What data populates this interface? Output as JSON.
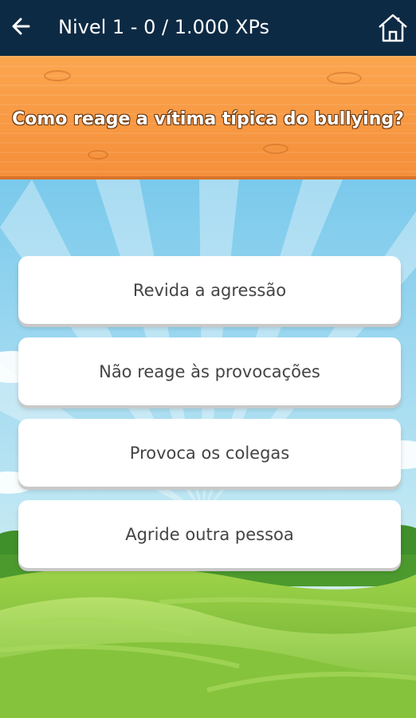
{
  "appbar": {
    "title": "Nivel 1 - 0 / 1.000 XPs",
    "back_icon": "arrow-left-icon",
    "home_icon": "home-icon",
    "background": "#0d2a44"
  },
  "question": {
    "text": "Como reage a vítima típica do bullying?"
  },
  "answers": [
    {
      "label": "Revida a agressão"
    },
    {
      "label": "Não reage às provocações"
    },
    {
      "label": "Provoca os colegas"
    },
    {
      "label": "Agride outra pessoa"
    }
  ],
  "colors": {
    "wood": "#f89a44",
    "sky": "#8fd0ee",
    "grass": "#7cbf3a",
    "answer_bg": "#ffffff",
    "answer_text": "#444444"
  }
}
